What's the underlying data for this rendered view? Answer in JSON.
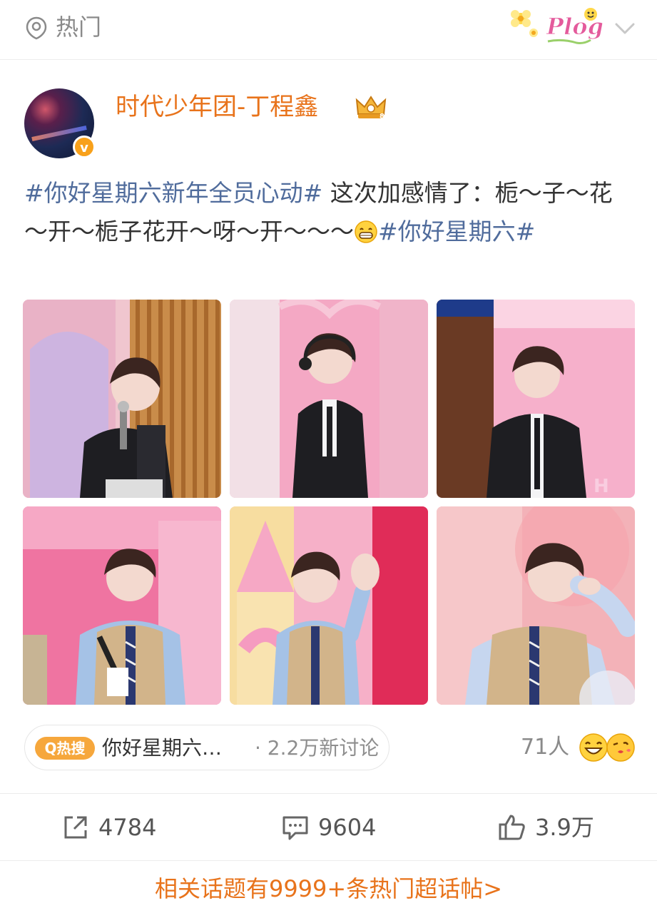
{
  "header": {
    "channel_label": "热门",
    "channel_icon": "hot-location-icon",
    "badge_text": "Plog",
    "expand_icon": "chevron-down-icon"
  },
  "post": {
    "author": {
      "name": "时代少年团-丁程鑫",
      "verified_badge": "v",
      "crown_icon": "crown-member-icon"
    },
    "text": {
      "tag1": "#你好星期六新年全员心动#",
      "body": " 这次加感情了：栀～子～花～开～栀子花开～呀～开～～～",
      "emoji": "grin-emoji-icon",
      "tag2": "#你好星期六#"
    },
    "photos": [
      {
        "id": "photo-1",
        "desc": "host-with-microphone"
      },
      {
        "id": "photo-2",
        "desc": "with-headset"
      },
      {
        "id": "photo-3",
        "desc": "leather-jacket"
      },
      {
        "id": "photo-4",
        "desc": "knit-vest-microphone"
      },
      {
        "id": "photo-5",
        "desc": "waving"
      },
      {
        "id": "photo-6",
        "desc": "hand-on-head"
      }
    ],
    "hot_search": {
      "tag_label": "Q热搜",
      "topic": "你好星期六…",
      "discussion": "· 2.2万新讨论"
    },
    "reactions": {
      "count": "71人"
    },
    "actions": {
      "repost": "4784",
      "comment": "9604",
      "like": "3.9万"
    },
    "related_link": "相关话题有9999+条热门超话帖>"
  },
  "colors": {
    "accent_orange": "#e8731b",
    "topic_blue": "#506c9c",
    "hot_tag": "#f6a73c"
  }
}
